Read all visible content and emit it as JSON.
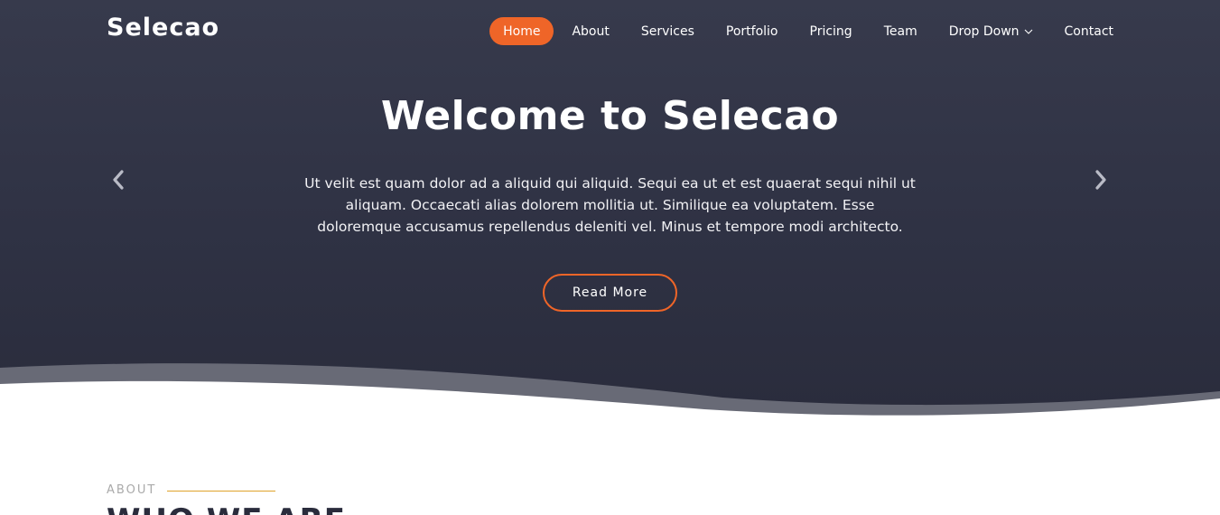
{
  "header": {
    "logo": "Selecao",
    "nav": [
      {
        "label": "Home",
        "active": true
      },
      {
        "label": "About"
      },
      {
        "label": "Services"
      },
      {
        "label": "Portfolio"
      },
      {
        "label": "Pricing"
      },
      {
        "label": "Team"
      },
      {
        "label": "Drop Down",
        "has_dropdown": true
      },
      {
        "label": "Contact"
      }
    ]
  },
  "hero": {
    "title": "Welcome to Selecao",
    "text": "Ut velit est quam dolor ad a aliquid qui aliquid. Sequi ea ut et est quaerat sequi nihil ut aliquam. Occaecati alias dolorem mollitia ut. Similique ea voluptatem. Esse doloremque accusamus repellendus deleniti vel. Minus et tempore modi architecto.",
    "button": "Read More",
    "prev_icon": "chevron-left-icon",
    "next_icon": "chevron-right-icon"
  },
  "about": {
    "label": "ABOUT",
    "heading": "WHO WE ARE"
  },
  "colors": {
    "accent": "#ef6528",
    "hero_bg": "#2f3244",
    "about_line": "#e0a32c"
  }
}
